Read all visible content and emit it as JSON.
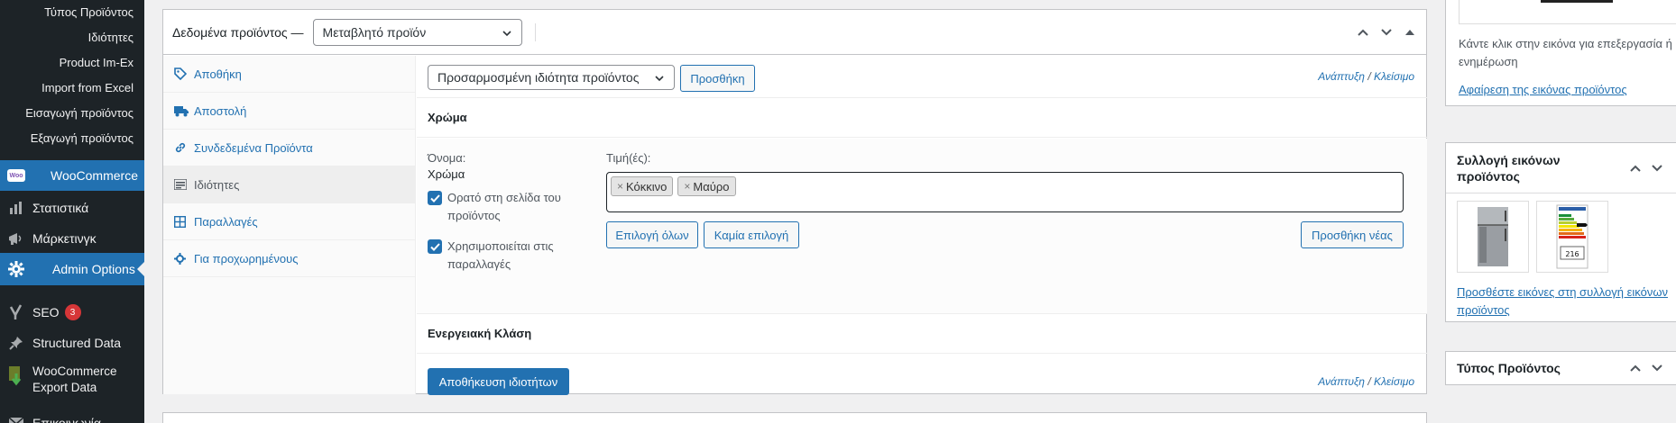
{
  "sidebar": {
    "sub_items": [
      "Τύπος Προϊόντος",
      "Ιδιότητες",
      "Product Im-Ex",
      "Import from Excel",
      "Εισαγωγή προϊόντος",
      "Εξαγωγή προϊόντος"
    ],
    "woocommerce": "WooCommerce",
    "woo_icon": "Woo",
    "statistics": "Στατιστικά",
    "marketing": "Μάρκετινγκ",
    "admin_options": "Admin Options",
    "seo": "SEO",
    "seo_count": "3",
    "structured_data": "Structured Data",
    "woo_export_line1": "WooCommerce",
    "woo_export_line2": "Export Data",
    "contact": "Επικοινωνία"
  },
  "panel": {
    "title": "Δεδομένα προϊόντος —",
    "product_type": "Μεταβλητό προϊόν"
  },
  "tabs": [
    {
      "label": "Αποθήκη",
      "icon": "tag-icon"
    },
    {
      "label": "Αποστολή",
      "icon": "truck-icon"
    },
    {
      "label": "Συνδεδεμένα Προϊόντα",
      "icon": "link-icon"
    },
    {
      "label": "Ιδιότητες",
      "icon": "list-icon"
    },
    {
      "label": "Παραλλαγές",
      "icon": "grid-icon"
    },
    {
      "label": "Για προχωρημένους",
      "icon": "gear-icon"
    }
  ],
  "attributes": {
    "custom_select": "Προσαρμοσμένη ιδιότητα προϊόντος",
    "add_button": "Προσθήκη",
    "expand": "Ανάπτυξη",
    "collapse": "Κλείσιμο",
    "separator": "/",
    "color_header": "Χρώμα",
    "name_label": "Όνομα:",
    "name_value": "Χρώμα",
    "visible_line1": "Ορατό στη σελίδα του",
    "visible_line2": "προϊόντος",
    "variations_line1": "Χρησιμοποιείται στις",
    "variations_line2": "παραλλαγές",
    "values_label": "Τιμή(ές):",
    "tags": [
      "Κόκκινο",
      "Μαύρο"
    ],
    "select_all": "Επιλογή όλων",
    "select_none": "Καμία επιλογή",
    "add_new": "Προσθήκη νέας",
    "energy_header": "Ενεργειακή Κλάση",
    "save_button": "Αποθήκευση ιδιοτήτων"
  },
  "right": {
    "image_help_line1": "Κάντε κλικ στην εικόνα για επεξεργασία ή",
    "image_help_line2": "ενημέρωση",
    "remove_image": "Αφαίρεση της εικόνας προϊόντος",
    "gallery_title_line1": "Συλλογή εικόνων",
    "gallery_title_line2": "προϊόντος",
    "gallery_add_line1": "Προσθέστε εικόνες στη συλλογή εικόνων",
    "gallery_add_line2": "προϊόντος",
    "energy_label_text": "216",
    "type_title": "Τύπος Προϊόντος"
  }
}
